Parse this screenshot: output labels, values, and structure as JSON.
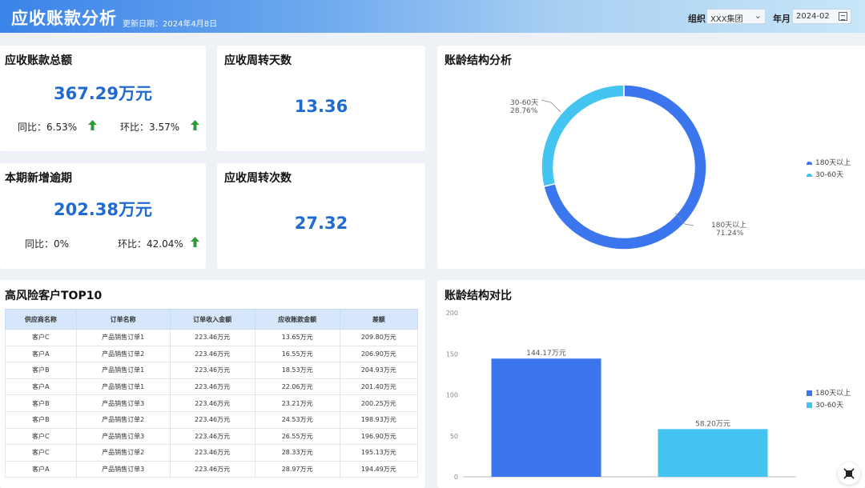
{
  "header": {
    "title": "应收账款分析",
    "updated": "更新日期：2024年4月8日",
    "org_label": "组织",
    "org_value": "XXX集团",
    "month_label": "年月",
    "month_value": "2024-02"
  },
  "colors": {
    "accent": "#1f6bd0",
    "bar_180": "#3b76ef",
    "bar_30": "#44c4f0",
    "up_arrow": "#2e9b3a"
  },
  "kpi": {
    "total": {
      "title": "应收账款总额",
      "value": "367.29万元",
      "yoy": "同比：6.53%",
      "mom": "环比：3.57%"
    },
    "turnover_days": {
      "title": "应收周转天数",
      "value": "13.36"
    },
    "overdue": {
      "title": "本期新增逾期",
      "value": "202.38万元",
      "yoy": "同比：0%",
      "mom": "环比：42.04%"
    },
    "turnover_times": {
      "title": "应收周转次数",
      "value": "27.32"
    }
  },
  "aging_pie": {
    "title": "账龄结构分析"
  },
  "risk": {
    "title": "高风险客户TOP10",
    "columns": [
      "供应商名称",
      "订单名称",
      "订单收入金额",
      "应收账款金额",
      "差额"
    ],
    "rows": [
      [
        "客户C",
        "产品销售订单1",
        "223.46万元",
        "13.65万元",
        "209.80万元"
      ],
      [
        "客户A",
        "产品销售订单2",
        "223.46万元",
        "16.55万元",
        "206.90万元"
      ],
      [
        "客户B",
        "产品销售订单1",
        "223.46万元",
        "18.53万元",
        "204.93万元"
      ],
      [
        "客户A",
        "产品销售订单1",
        "223.46万元",
        "22.06万元",
        "201.40万元"
      ],
      [
        "客户B",
        "产品销售订单3",
        "223.46万元",
        "23.21万元",
        "200.25万元"
      ],
      [
        "客户B",
        "产品销售订单2",
        "223.46万元",
        "24.53万元",
        "198.93万元"
      ],
      [
        "客户C",
        "产品销售订单3",
        "223.46万元",
        "26.55万元",
        "196.90万元"
      ],
      [
        "客户C",
        "产品销售订单2",
        "223.46万元",
        "28.33万元",
        "195.13万元"
      ],
      [
        "客户A",
        "产品销售订单3",
        "223.46万元",
        "28.97万元",
        "194.49万元"
      ]
    ]
  },
  "aging_bar": {
    "title": "账龄结构对比"
  },
  "chart_data": [
    {
      "type": "pie",
      "title": "账龄结构分析",
      "donut": true,
      "series": [
        {
          "name": "180天以上",
          "value": 71.24,
          "label": "180天以上",
          "pct_label": "71.24%",
          "color": "#3b76ef"
        },
        {
          "name": "30-60天",
          "value": 28.76,
          "label": "30-60天",
          "pct_label": "28.76%",
          "color": "#44c4f0"
        }
      ],
      "legend": [
        "180天以上",
        "30-60天"
      ],
      "legend_position": "right"
    },
    {
      "type": "bar",
      "title": "账龄结构对比",
      "categories": [
        "180天以上",
        "30-60天"
      ],
      "values": [
        144.17,
        58.2
      ],
      "data_labels": [
        "144.17万元",
        "58.20万元"
      ],
      "colors": [
        "#3b76ef",
        "#44c4f0"
      ],
      "ylim": [
        0,
        200
      ],
      "yticks": [
        "0",
        "50",
        "100",
        "150",
        "200"
      ],
      "legend": [
        "180天以上",
        "30-60天"
      ],
      "legend_position": "right",
      "grid": false
    }
  ]
}
